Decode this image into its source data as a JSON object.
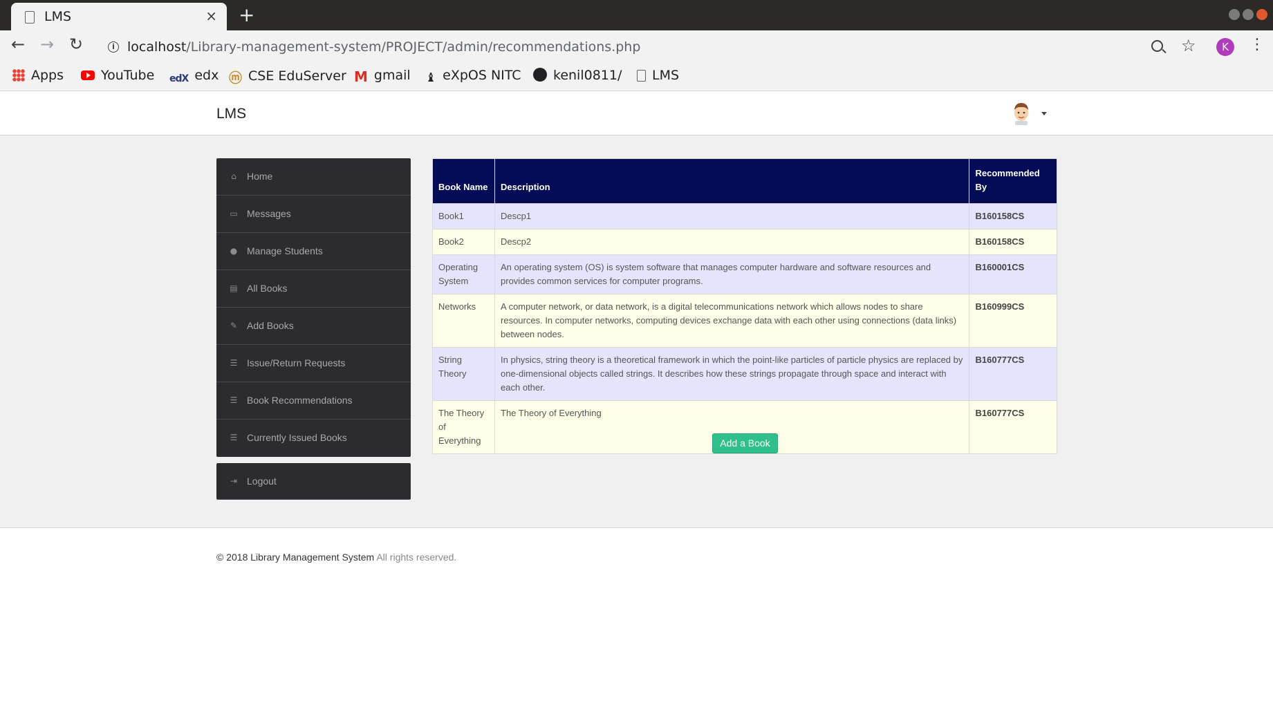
{
  "browser": {
    "tab_title": "LMS",
    "tab_close": "×",
    "new_tab": "+",
    "url_host": "localhost",
    "url_path": "/Library-management-system/PROJECT/admin/recommendations.php",
    "profile_initial": "K",
    "bookmarks": [
      {
        "label": "Apps",
        "icon": "apps-grid-icon"
      },
      {
        "label": "YouTube",
        "icon": "youtube-icon"
      },
      {
        "label": "edx",
        "icon": "edx-icon"
      },
      {
        "label": "CSE EduServer",
        "icon": "eduserver-icon"
      },
      {
        "label": "gmail",
        "icon": "gmail-icon"
      },
      {
        "label": "eXpOS NITC",
        "icon": "expos-icon"
      },
      {
        "label": "kenil0811/",
        "icon": "github-icon"
      },
      {
        "label": "LMS",
        "icon": "document-icon"
      }
    ]
  },
  "header": {
    "brand": "LMS"
  },
  "sidebar": {
    "items": [
      {
        "label": "Home",
        "icon": "home-icon"
      },
      {
        "label": "Messages",
        "icon": "inbox-icon"
      },
      {
        "label": "Manage Students",
        "icon": "user-icon"
      },
      {
        "label": "All Books",
        "icon": "book-icon"
      },
      {
        "label": "Add Books",
        "icon": "edit-icon"
      },
      {
        "label": "Issue/Return Requests",
        "icon": "list-icon"
      },
      {
        "label": "Book Recommendations",
        "icon": "list-icon"
      },
      {
        "label": "Currently Issued Books",
        "icon": "list-icon"
      }
    ],
    "logout": {
      "label": "Logout",
      "icon": "signout-icon"
    }
  },
  "table": {
    "headers": [
      "Book Name",
      "Description",
      "Recommended By"
    ],
    "rows": [
      {
        "book": "Book1",
        "description": "Descp1",
        "by": "B160158CS"
      },
      {
        "book": "Book2",
        "description": "Descp2",
        "by": "B160158CS"
      },
      {
        "book": "Operating System",
        "description": "An operating system (OS) is system software that manages computer hardware and software resources and provides common services for computer programs.",
        "by": "B160001CS"
      },
      {
        "book": "Networks",
        "description": "A computer network, or data network, is a digital telecommunications network which allows nodes to share resources. In computer networks, computing devices exchange data with each other using connections (data links) between nodes.",
        "by": "B160999CS"
      },
      {
        "book": "String Theory",
        "description": "In physics, string theory is a theoretical framework in which the point-like particles of particle physics are replaced by one-dimensional objects called strings. It describes how these strings propagate through space and interact with each other.",
        "by": "B160777CS"
      },
      {
        "book": "The Theory of Everything",
        "description": "The Theory of Everything",
        "by": "B160777CS"
      }
    ]
  },
  "actions": {
    "add_book": "Add a Book"
  },
  "footer": {
    "copyright": "© 2018 Library Management System",
    "rights": "All rights reserved."
  },
  "colors": {
    "table_header_bg": "#040c55",
    "row_odd_bg": "#e4e4fc",
    "row_even_bg": "#fefee9",
    "sidebar_bg": "#2c2b30",
    "button_bg": "#2fbf8a"
  }
}
